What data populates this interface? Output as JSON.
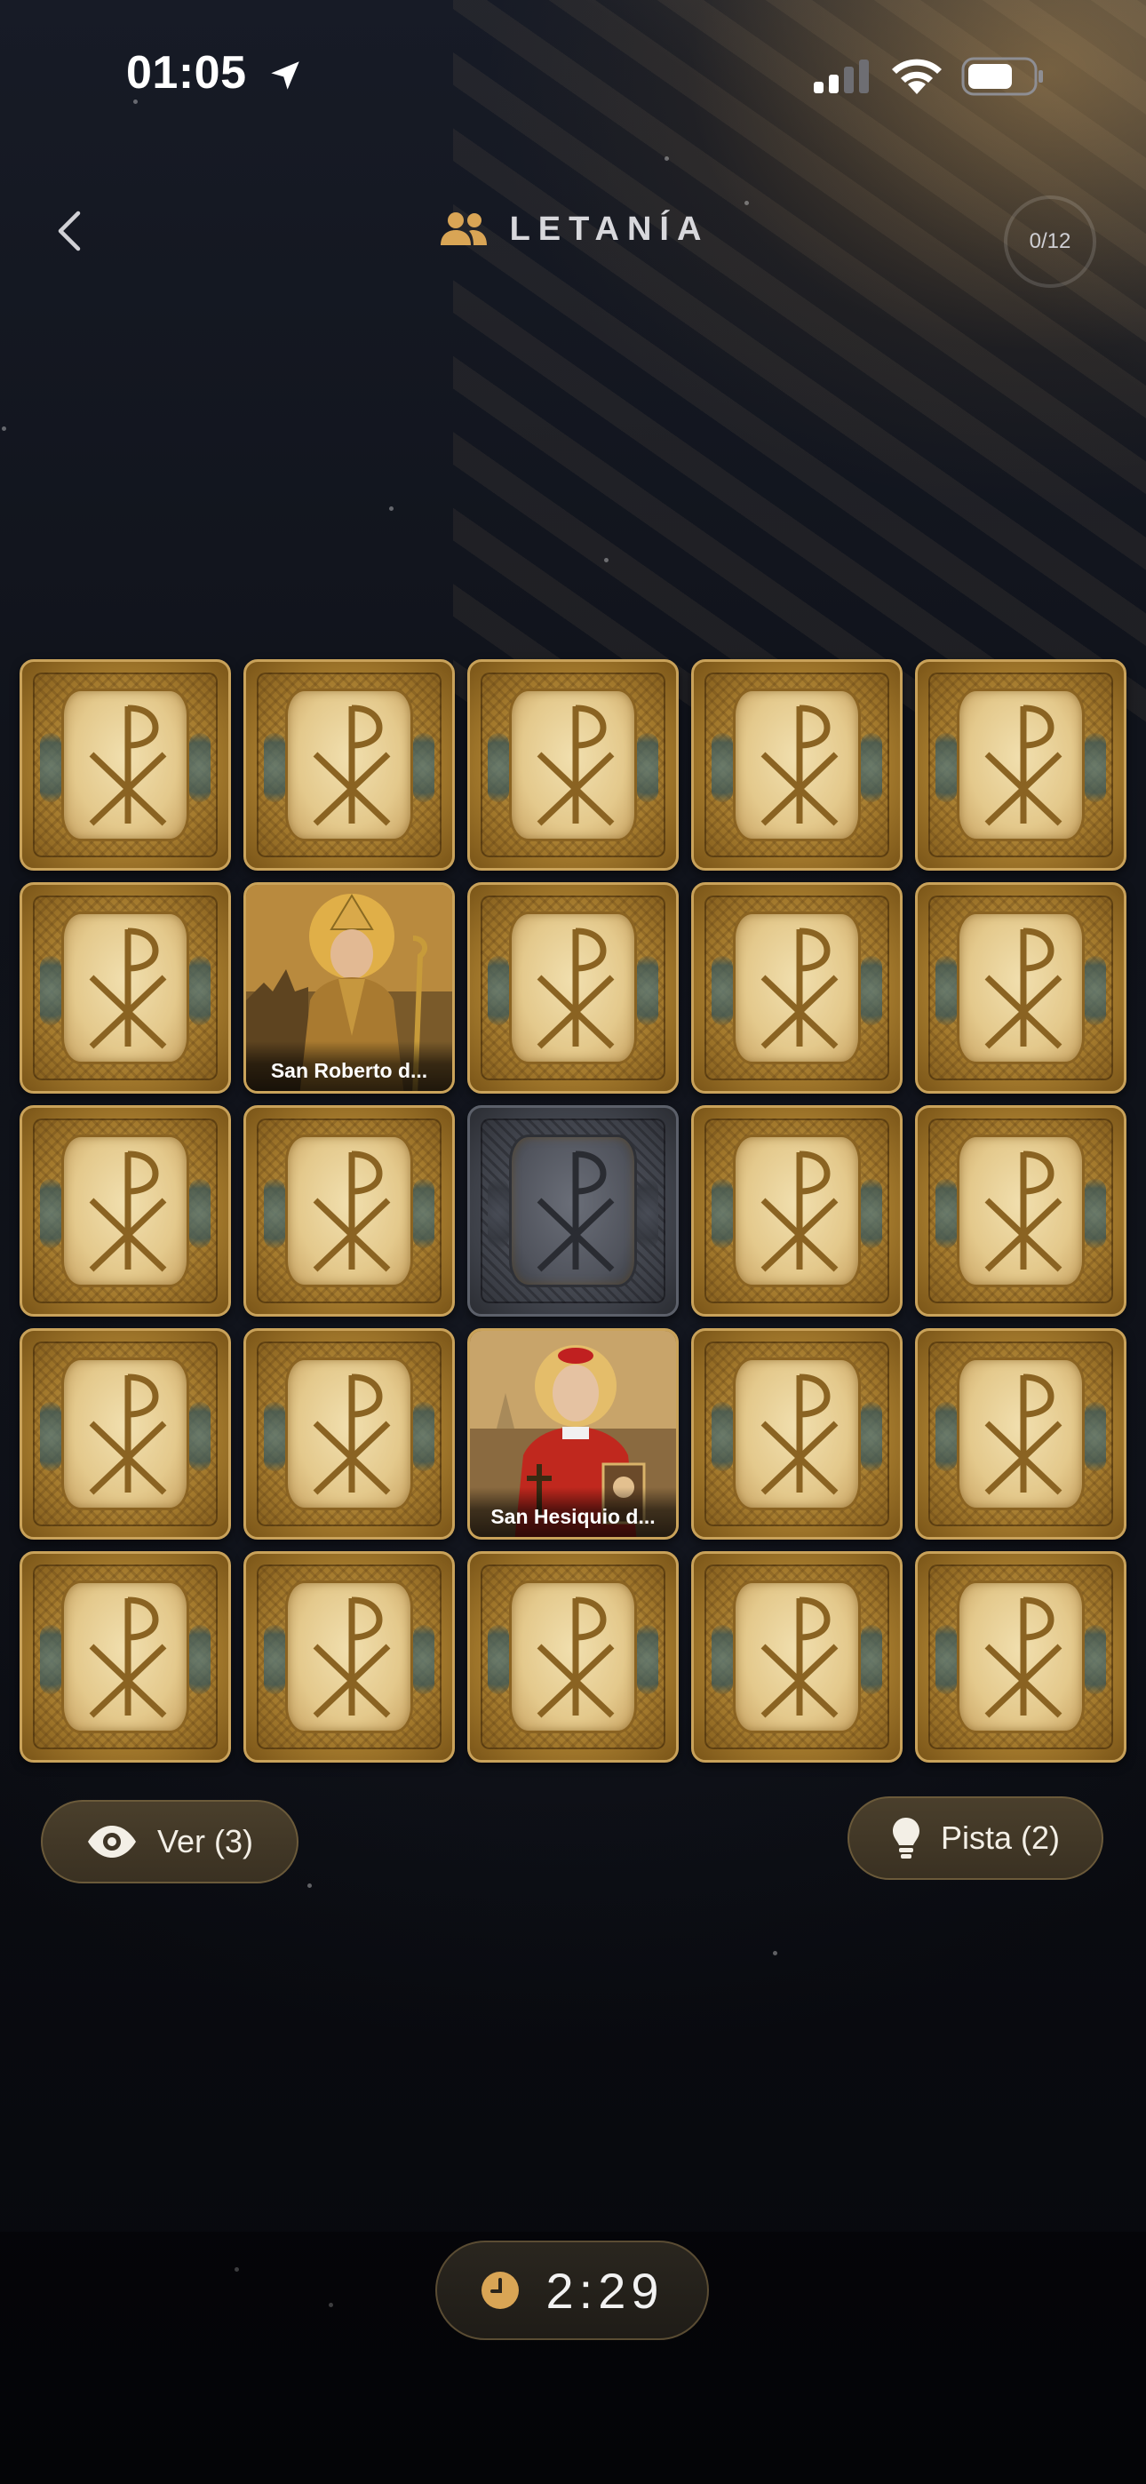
{
  "status_bar": {
    "time": "01:05",
    "battery_level": 0.7
  },
  "header": {
    "title": "LETANÍA",
    "progress": "0/12"
  },
  "board": {
    "columns": 5,
    "rows": 5,
    "cards": [
      {
        "state": "hidden"
      },
      {
        "state": "hidden"
      },
      {
        "state": "hidden"
      },
      {
        "state": "hidden"
      },
      {
        "state": "hidden"
      },
      {
        "state": "hidden"
      },
      {
        "state": "revealed",
        "caption": "San Roberto d..."
      },
      {
        "state": "hidden"
      },
      {
        "state": "hidden"
      },
      {
        "state": "hidden"
      },
      {
        "state": "hidden"
      },
      {
        "state": "hidden"
      },
      {
        "state": "disabled"
      },
      {
        "state": "hidden"
      },
      {
        "state": "hidden"
      },
      {
        "state": "hidden"
      },
      {
        "state": "hidden"
      },
      {
        "state": "revealed",
        "caption": "San Hesiquio d..."
      },
      {
        "state": "hidden"
      },
      {
        "state": "hidden"
      },
      {
        "state": "hidden"
      },
      {
        "state": "hidden"
      },
      {
        "state": "hidden"
      },
      {
        "state": "hidden"
      },
      {
        "state": "hidden"
      }
    ]
  },
  "actions": {
    "ver_label": "Ver (3)",
    "pista_label": "Pista (2)"
  },
  "timer": {
    "value": "2:29"
  },
  "colors": {
    "accent": "#d9a555",
    "card_gold": "#c9a25a",
    "background": "#0b0d13"
  }
}
